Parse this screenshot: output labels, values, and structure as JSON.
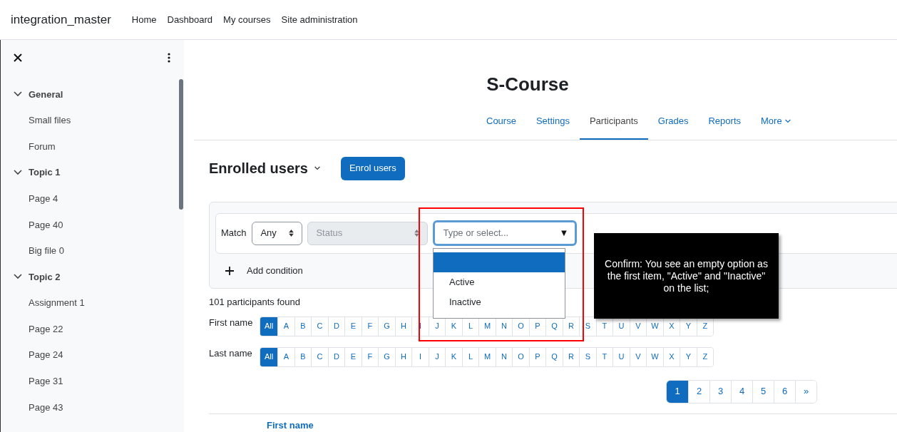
{
  "navbar": {
    "site_name": "integration_master",
    "links": [
      "Home",
      "Dashboard",
      "My courses",
      "Site administration"
    ]
  },
  "sidebar": {
    "sections": [
      {
        "title": "General",
        "expanded": true,
        "items": [
          "Small files",
          "Forum"
        ]
      },
      {
        "title": "Topic 1",
        "expanded": true,
        "items": [
          "Page 4",
          "Page 40",
          "Big file 0"
        ]
      },
      {
        "title": "Topic 2",
        "expanded": true,
        "items": [
          "Assignment 1",
          "Page 22",
          "Page 24",
          "Page 31",
          "Page 43"
        ]
      }
    ]
  },
  "course_title": "S-Course",
  "tabs": [
    {
      "label": "Course",
      "selected": false
    },
    {
      "label": "Settings",
      "selected": false
    },
    {
      "label": "Participants",
      "selected": true
    },
    {
      "label": "Grades",
      "selected": false
    },
    {
      "label": "Reports",
      "selected": false
    },
    {
      "label": "More",
      "selected": false
    }
  ],
  "heading": "Enrolled users",
  "enrol_button": "Enrol users",
  "filter": {
    "match_label": "Match",
    "match_value": "Any",
    "type_value": "Status",
    "type_disabled": true,
    "value_placeholder": "Type or select...",
    "dropdown_arrow": "▼",
    "options": [
      {
        "selected": true
      },
      {
        "label": "Active",
        "selected": false
      },
      {
        "label": "Inactive",
        "selected": false
      }
    ],
    "add_condition": "Add condition"
  },
  "participants_found": "101 participants found",
  "initials_bars": [
    {
      "label": "First name",
      "letters": [
        {
          "label": "All",
          "selected": true
        },
        {
          "label": "A",
          "selected": false
        },
        {
          "label": "B",
          "selected": false
        },
        {
          "label": "C",
          "selected": false
        },
        {
          "label": "D",
          "selected": false
        },
        {
          "label": "E",
          "selected": false
        },
        {
          "label": "F",
          "selected": false
        },
        {
          "label": "G",
          "selected": false
        },
        {
          "label": "H",
          "selected": false
        },
        {
          "label": "I",
          "selected": false
        },
        {
          "label": "J",
          "selected": false
        },
        {
          "label": "K",
          "selected": false
        },
        {
          "label": "L",
          "selected": false
        },
        {
          "label": "M",
          "selected": false
        },
        {
          "label": "N",
          "selected": false
        },
        {
          "label": "O",
          "selected": false
        },
        {
          "label": "P",
          "selected": false
        },
        {
          "label": "Q",
          "selected": false
        },
        {
          "label": "R",
          "selected": false
        },
        {
          "label": "S",
          "selected": false
        },
        {
          "label": "T",
          "selected": false
        },
        {
          "label": "U",
          "selected": false
        },
        {
          "label": "V",
          "selected": false
        },
        {
          "label": "W",
          "selected": false
        },
        {
          "label": "X",
          "selected": false
        },
        {
          "label": "Y",
          "selected": false
        },
        {
          "label": "Z",
          "selected": false
        }
      ]
    },
    {
      "label": "Last name",
      "letters": [
        {
          "label": "All",
          "selected": true
        },
        {
          "label": "A",
          "selected": false
        },
        {
          "label": "B",
          "selected": false
        },
        {
          "label": "C",
          "selected": false
        },
        {
          "label": "D",
          "selected": false
        },
        {
          "label": "E",
          "selected": false
        },
        {
          "label": "F",
          "selected": false
        },
        {
          "label": "G",
          "selected": false
        },
        {
          "label": "H",
          "selected": false
        },
        {
          "label": "I",
          "selected": false
        },
        {
          "label": "J",
          "selected": false
        },
        {
          "label": "K",
          "selected": false
        },
        {
          "label": "L",
          "selected": false
        },
        {
          "label": "M",
          "selected": false
        },
        {
          "label": "N",
          "selected": false
        },
        {
          "label": "O",
          "selected": false
        },
        {
          "label": "P",
          "selected": false
        },
        {
          "label": "Q",
          "selected": false
        },
        {
          "label": "R",
          "selected": false
        },
        {
          "label": "S",
          "selected": false
        },
        {
          "label": "T",
          "selected": false
        },
        {
          "label": "U",
          "selected": false
        },
        {
          "label": "V",
          "selected": false
        },
        {
          "label": "W",
          "selected": false
        },
        {
          "label": "X",
          "selected": false
        },
        {
          "label": "Y",
          "selected": false
        },
        {
          "label": "Z",
          "selected": false
        }
      ]
    }
  ],
  "pagination": [
    {
      "label": "1",
      "selected": true
    },
    {
      "label": "2",
      "selected": false
    },
    {
      "label": "3",
      "selected": false
    },
    {
      "label": "4",
      "selected": false
    },
    {
      "label": "5",
      "selected": false
    },
    {
      "label": "6",
      "selected": false
    },
    {
      "label": "»",
      "selected": false
    }
  ],
  "table": {
    "columns": [
      "First name"
    ]
  },
  "annotation": {
    "note": "Confirm: You see an empty option as the first item, \"Active\" and \"Inactive\" on the list;"
  }
}
